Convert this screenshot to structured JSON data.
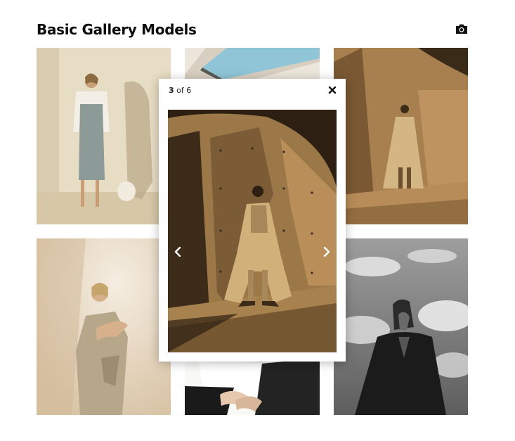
{
  "gallery": {
    "title": "Basic Gallery Models",
    "camera_icon": "camera-icon"
  },
  "thumbnails": [
    {
      "id": 1,
      "alt": "Model in grey dress with white blazer"
    },
    {
      "id": 2,
      "alt": "Pool from above"
    },
    {
      "id": 3,
      "alt": "Model in trench coat against concrete wall"
    },
    {
      "id": 4,
      "alt": "Model in beige knotted dress"
    },
    {
      "id": 5,
      "alt": "Hands and white shirt"
    },
    {
      "id": 6,
      "alt": "Black and white model against sky"
    }
  ],
  "lightbox": {
    "current": "3",
    "of_text": " of ",
    "total": "6",
    "close_icon": "close-icon",
    "prev_icon": "chevron-left-icon",
    "next_icon": "chevron-right-icon"
  },
  "colors": {
    "title": "#0d0d0d",
    "lightbox_bg": "#ffffff",
    "wall_warm": "#b38a59",
    "shadow": "#2a1e12"
  }
}
